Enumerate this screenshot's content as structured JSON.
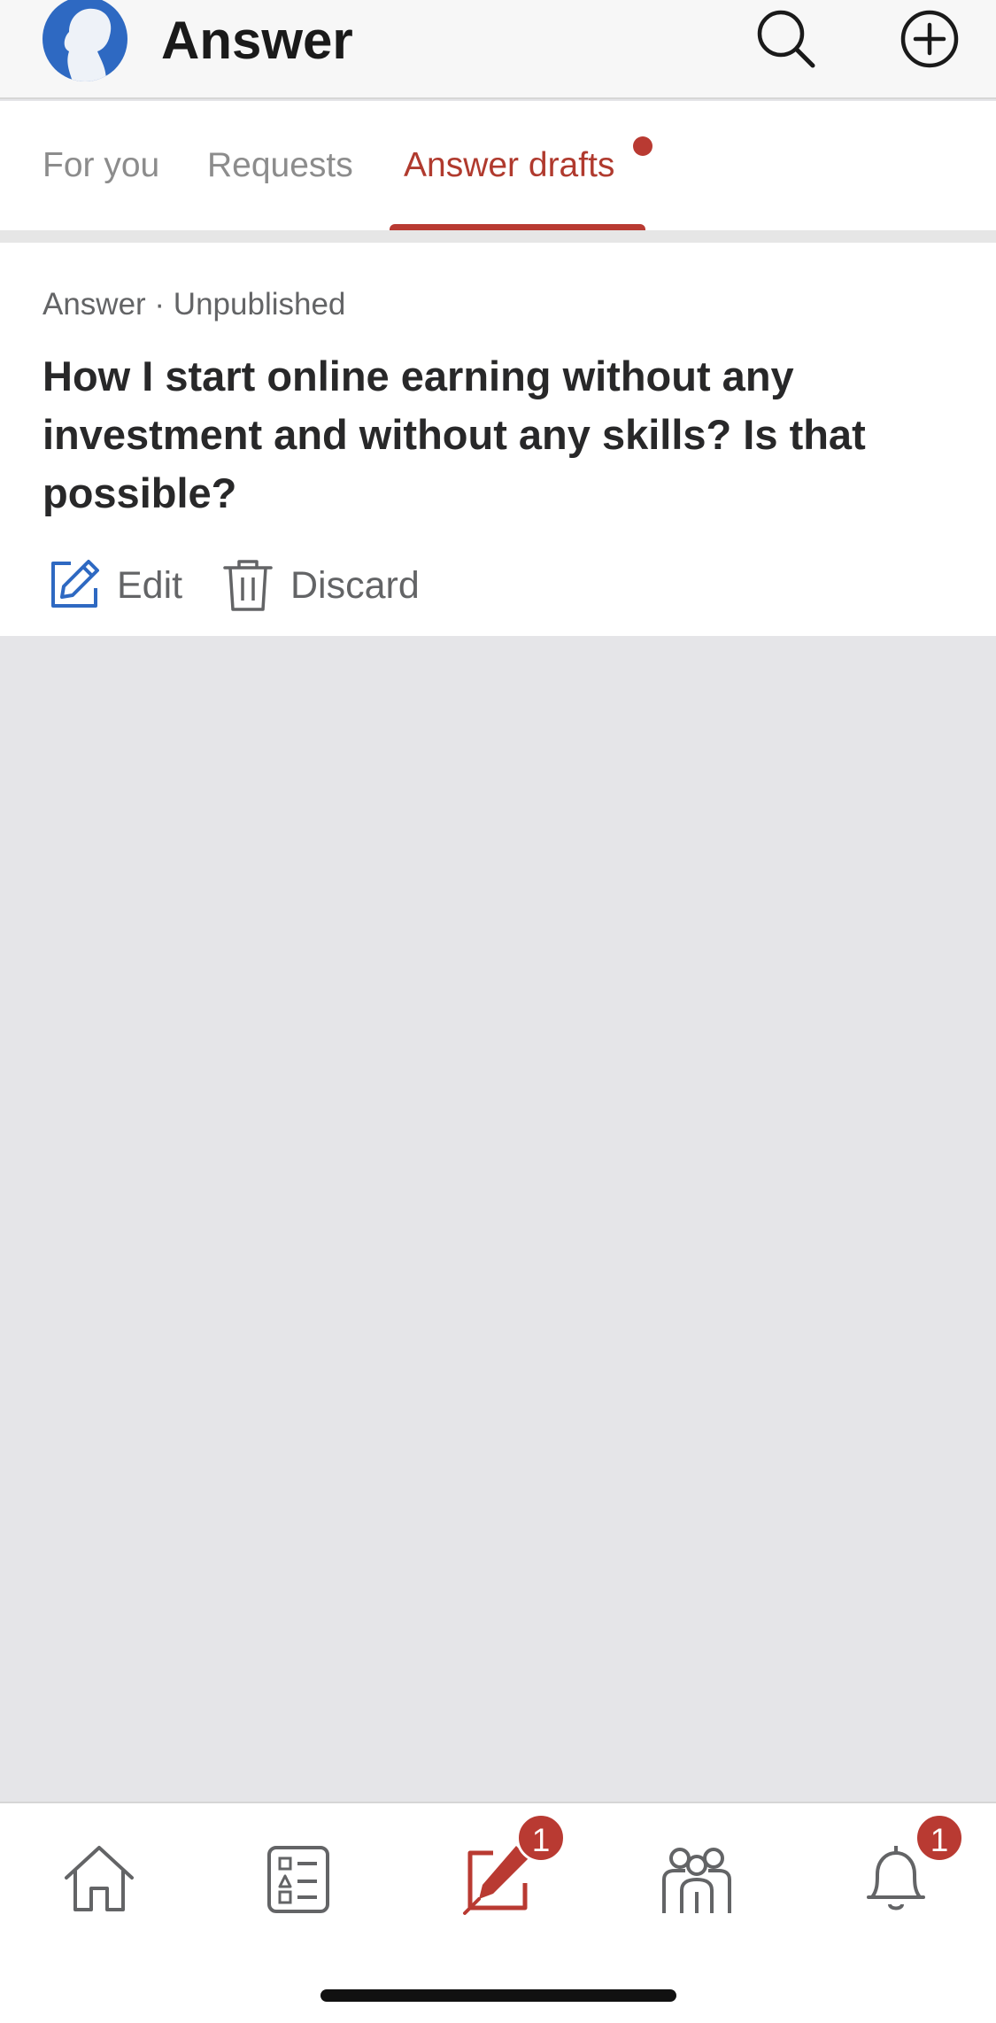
{
  "header": {
    "title": "Answer",
    "avatar_icon": "user-silhouette-avatar",
    "search_icon": "search-icon",
    "add_icon": "plus-circle-icon"
  },
  "tabs": [
    {
      "label": "For you",
      "active": false
    },
    {
      "label": "Requests",
      "active": false
    },
    {
      "label": "Answer drafts",
      "active": true,
      "has_dot": true
    }
  ],
  "draft": {
    "meta": "Answer · Unpublished",
    "question": "How I start online earning without any investment and without any skills? Is that possible?",
    "edit_label": "Edit",
    "discard_label": "Discard"
  },
  "bottom_nav": {
    "items": [
      {
        "icon": "home-icon"
      },
      {
        "icon": "following-list-icon"
      },
      {
        "icon": "answer-pencil-icon",
        "active": true,
        "badge": "1"
      },
      {
        "icon": "spaces-people-icon"
      },
      {
        "icon": "bell-icon",
        "badge": "1"
      }
    ]
  },
  "colors": {
    "accent": "#b93a32",
    "link_blue": "#2e69c2",
    "background": "#e5e5e8"
  }
}
